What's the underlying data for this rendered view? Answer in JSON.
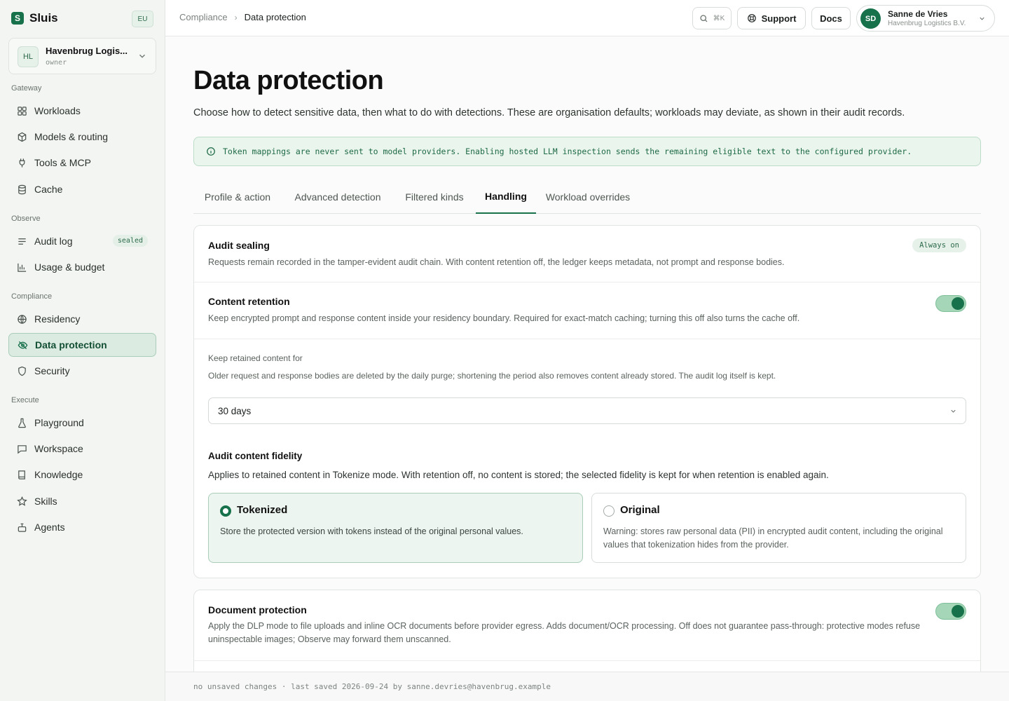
{
  "app": {
    "name": "Sluis",
    "region": "EU"
  },
  "org": {
    "initials": "HL",
    "name": "Havenbrug Logis...",
    "role": "owner"
  },
  "sidebar": {
    "sections": [
      {
        "label": "Gateway",
        "items": [
          {
            "label": "Workloads",
            "icon": "grid-icon"
          },
          {
            "label": "Models & routing",
            "icon": "cube-icon"
          },
          {
            "label": "Tools & MCP",
            "icon": "plug-icon"
          },
          {
            "label": "Cache",
            "icon": "database-icon"
          }
        ]
      },
      {
        "label": "Observe",
        "items": [
          {
            "label": "Audit log",
            "icon": "list-icon",
            "badge": "sealed"
          },
          {
            "label": "Usage & budget",
            "icon": "bar-chart-icon"
          }
        ]
      },
      {
        "label": "Compliance",
        "items": [
          {
            "label": "Residency",
            "icon": "globe-icon"
          },
          {
            "label": "Data protection",
            "icon": "eye-off-icon",
            "active": true
          },
          {
            "label": "Security",
            "icon": "shield-icon"
          }
        ]
      },
      {
        "label": "Execute",
        "items": [
          {
            "label": "Playground",
            "icon": "flask-icon"
          },
          {
            "label": "Workspace",
            "icon": "chat-icon"
          },
          {
            "label": "Knowledge",
            "icon": "book-icon"
          },
          {
            "label": "Skills",
            "icon": "star-icon"
          },
          {
            "label": "Agents",
            "icon": "robot-icon"
          }
        ]
      }
    ]
  },
  "header": {
    "breadcrumb": [
      "Compliance",
      "Data protection"
    ],
    "search_shortcut": "⌘K",
    "support_label": "Support",
    "docs_label": "Docs",
    "user": {
      "initials": "SD",
      "name": "Sanne de Vries",
      "org": "Havenbrug Logistics B.V."
    }
  },
  "page": {
    "title": "Data protection",
    "description": "Choose how to detect sensitive data, then what to do with detections. These are organisation defaults; workloads may deviate, as shown in their audit records.",
    "notice": "Token mappings are never sent to model providers. Enabling hosted LLM inspection sends the remaining eligible text to the configured provider.",
    "tabs": [
      "Profile & action",
      "Advanced detection",
      "Filtered kinds",
      "Handling",
      "Workload overrides"
    ],
    "active_tab": "Handling"
  },
  "handling": {
    "audit_sealing": {
      "title": "Audit sealing",
      "badge": "Always on",
      "description": "Requests remain recorded in the tamper-evident audit chain. With content retention off, the ledger keeps metadata, not prompt and response bodies."
    },
    "content_retention": {
      "title": "Content retention",
      "enabled": true,
      "description": "Keep encrypted prompt and response content inside your residency boundary. Required for exact-match caching; turning this off also turns the cache off."
    },
    "retention_period": {
      "label": "Keep retained content for",
      "description": "Older request and response bodies are deleted by the daily purge; shortening the period also removes content already stored. The audit log itself is kept.",
      "value": "30 days"
    },
    "fidelity": {
      "title": "Audit content fidelity",
      "description": "Applies to retained content in Tokenize mode. With retention off, no content is stored; the selected fidelity is kept for when retention is enabled again.",
      "options": [
        {
          "title": "Tokenized",
          "description": "Store the protected version with tokens instead of the original personal values.",
          "selected": true
        },
        {
          "title": "Original",
          "description": "Warning: stores raw personal data (PII) in encrypted audit content, including the original values that tokenization hides from the provider.",
          "selected": false
        }
      ]
    },
    "document_protection": {
      "title": "Document protection",
      "enabled": true,
      "description": "Apply the DLP mode to file uploads and inline OCR documents before provider egress. Adds document/OCR processing. Off does not guarantee pass-through: protective modes refuse uninspectable images; Observe may forward them unscanned."
    }
  },
  "footer": {
    "status": "no unsaved changes · last saved 2026-09-24 by sanne.devries@havenbrug.example"
  },
  "colors": {
    "accent": "#17714a",
    "accent_soft": "#dcebe2",
    "notice_bg": "#eaf5ee"
  }
}
